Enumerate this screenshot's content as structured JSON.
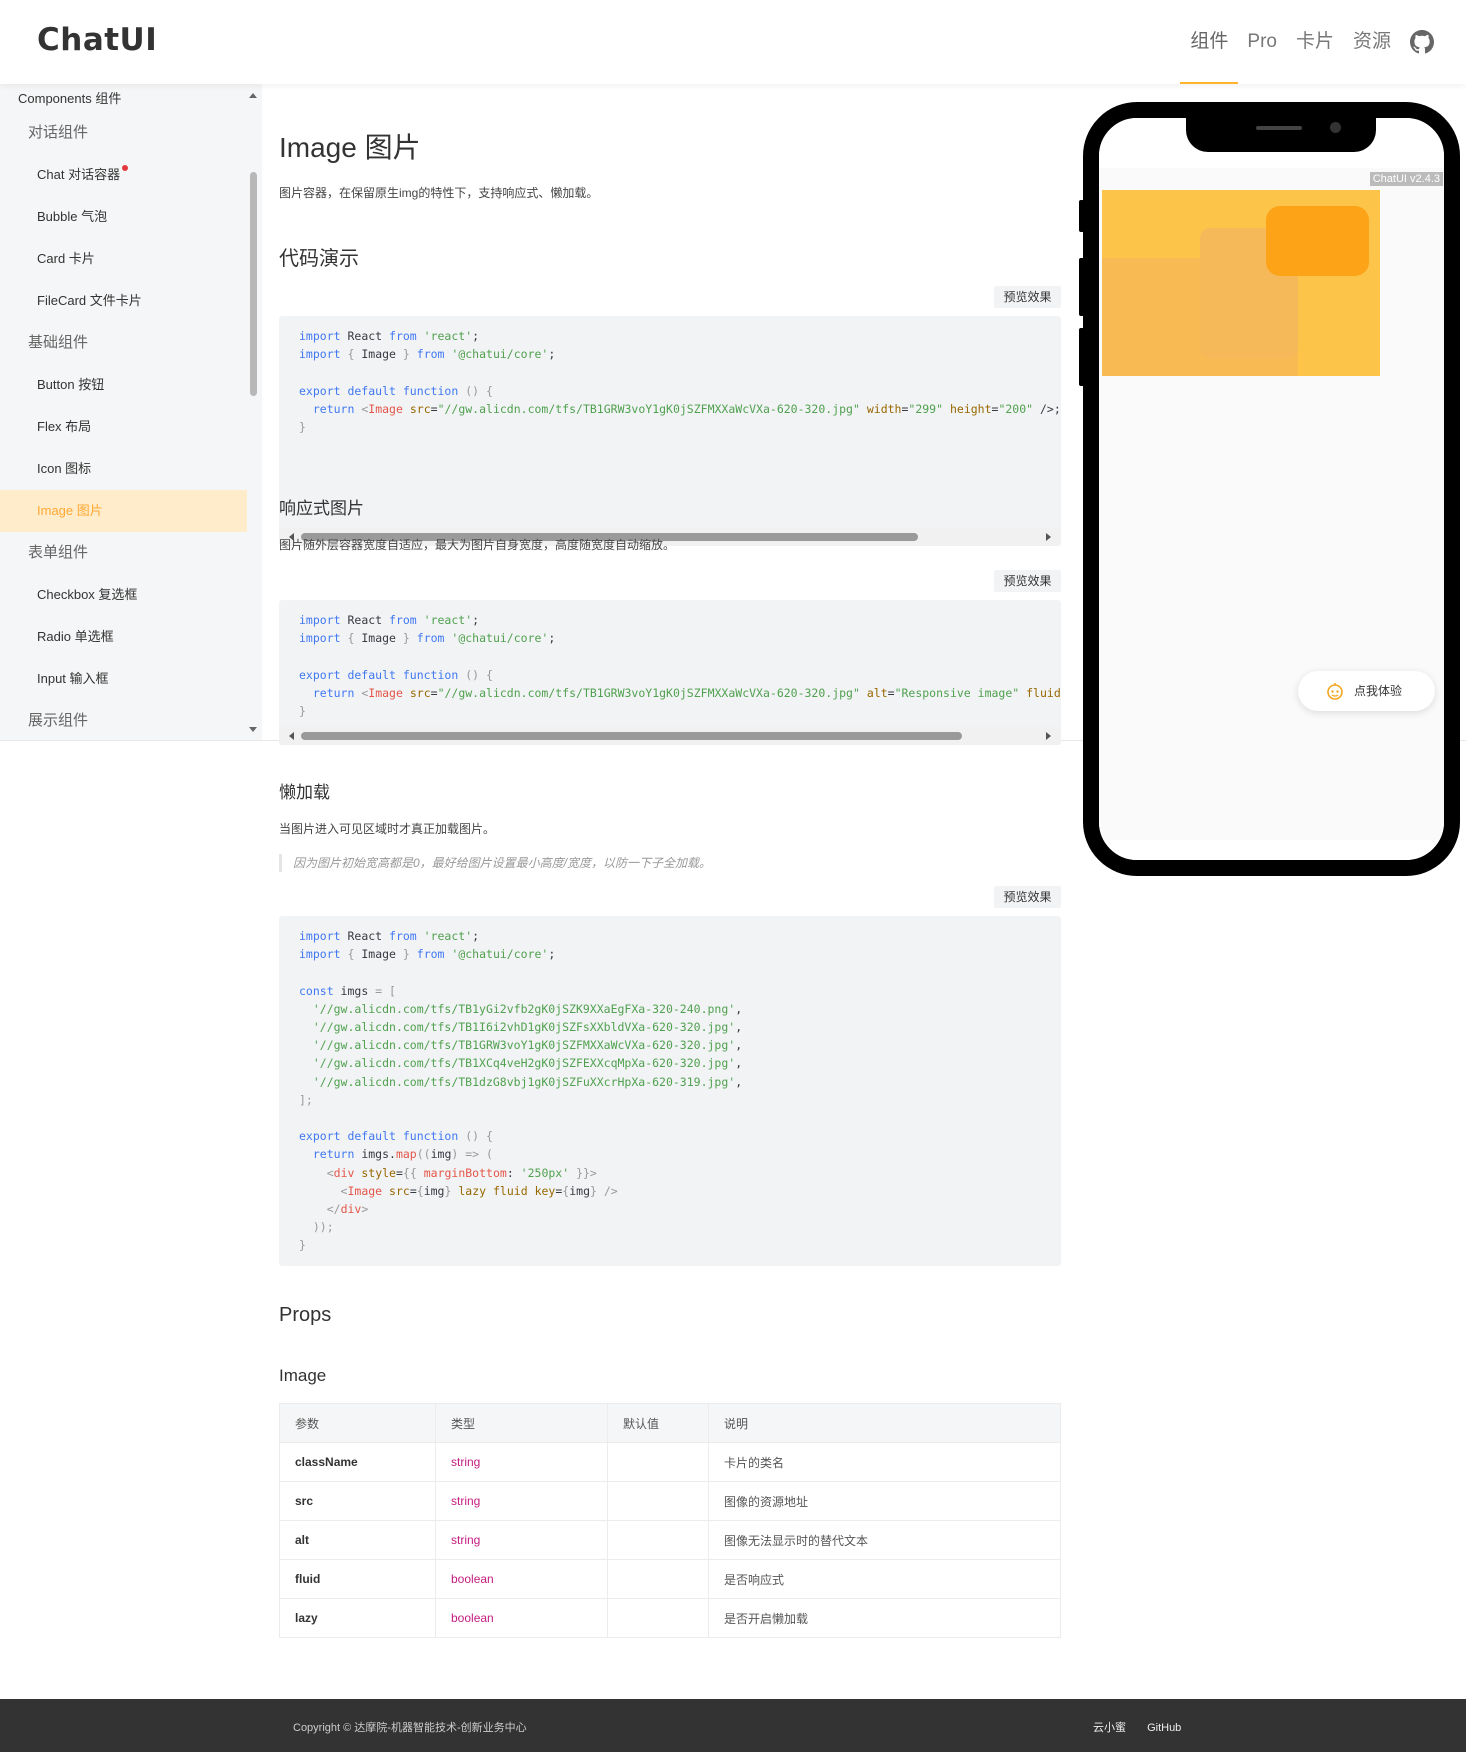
{
  "header": {
    "logo": "ChatUI",
    "nav": [
      "组件",
      "Pro",
      "卡片",
      "资源"
    ],
    "github_icon": "github-icon"
  },
  "sidebar": {
    "title": "Components 组件",
    "groups": [
      {
        "label": "对话组件",
        "items": [
          "Chat 对话容器",
          "Bubble 气泡",
          "Card 卡片",
          "FileCard 文件卡片"
        ]
      },
      {
        "label": "基础组件",
        "items": [
          "Button 按钮",
          "Flex 布局",
          "Icon 图标",
          "Image 图片"
        ]
      },
      {
        "label": "表单组件",
        "items": [
          "Checkbox 复选框",
          "Radio 单选框",
          "Input 输入框"
        ]
      },
      {
        "label": "展示组件",
        "items": []
      }
    ],
    "active_item": "Image 图片"
  },
  "page": {
    "title": "Image 图片",
    "intro": "图片容器，在保留原生img的特性下，支持响应式、懒加载。",
    "demo_heading": "代码演示",
    "preview_label": "预览效果",
    "sections": [
      {
        "title": "",
        "desc": ""
      },
      {
        "title": "响应式图片",
        "desc": "图片随外层容器宽度自适应，最大为图片自身宽度，高度随宽度自动缩放。"
      },
      {
        "title": "懒加载",
        "desc": "当图片进入可见区域时才真正加载图片。",
        "note": "因为图片初始宽高都是0，最好给图片设置最小高度/宽度，以防一下子全加载。"
      }
    ],
    "props_heading": "Props",
    "props_sub": "Image",
    "props_columns": [
      "参数",
      "类型",
      "默认值",
      "说明"
    ],
    "props_rows": [
      [
        "className",
        "string",
        "",
        "卡片的类名"
      ],
      [
        "src",
        "string",
        "",
        "图像的资源地址"
      ],
      [
        "alt",
        "string",
        "",
        "图像无法显示时的替代文本"
      ],
      [
        "fluid",
        "boolean",
        "",
        "是否响应式"
      ],
      [
        "lazy",
        "boolean",
        "",
        "是否开启懒加载"
      ]
    ]
  },
  "phone": {
    "version": "ChatUI v2.4.3",
    "try_label": "点我体验"
  },
  "footer": {
    "copyright": "Copyright © 达摩院-机器智能技术-创新业务中心",
    "links": [
      "云小蜜",
      "GitHub"
    ]
  },
  "colors": {
    "accent": "#ffb32e",
    "active_bg": "#ffeccb",
    "active_text": "#ffa833",
    "footer_bg": "#333333"
  }
}
